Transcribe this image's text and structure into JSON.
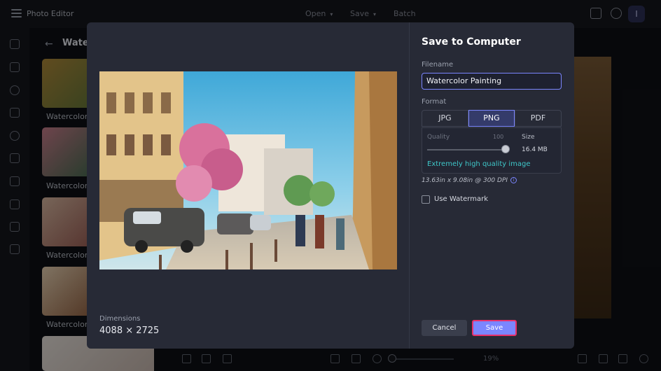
{
  "app": {
    "title": "Photo Editor",
    "avatar_initial": "I"
  },
  "top_menu": [
    "Open",
    "Save",
    "Batch"
  ],
  "panel": {
    "title": "Watercolor",
    "items": [
      "Watercolor",
      "Watercolor",
      "Watercolor",
      "Watercolor"
    ]
  },
  "zoom": {
    "value": "19%"
  },
  "dialog": {
    "title": "Save to Computer",
    "filename_label": "Filename",
    "filename_value": "Watercolor Painting",
    "format_label": "Format",
    "formats": [
      "JPG",
      "PNG",
      "PDF"
    ],
    "selected_format": "PNG",
    "quality_label": "Quality",
    "quality_value": "100",
    "size_label": "Size",
    "size_value": "16.4 MB",
    "quality_description": "Extremely high quality image",
    "print_size": "13.63in x 9.08in @ 300 DPI",
    "watermark_label": "Use Watermark",
    "watermark_checked": false,
    "dimensions_label": "Dimensions",
    "dimensions_value": "4088 × 2725",
    "cancel_label": "Cancel",
    "save_label": "Save"
  },
  "colors": {
    "accent": "#7b86ff",
    "quality_text": "#3fc6c8",
    "save_focus_ring": "#e8306a",
    "modal_bg": "#272a36"
  }
}
